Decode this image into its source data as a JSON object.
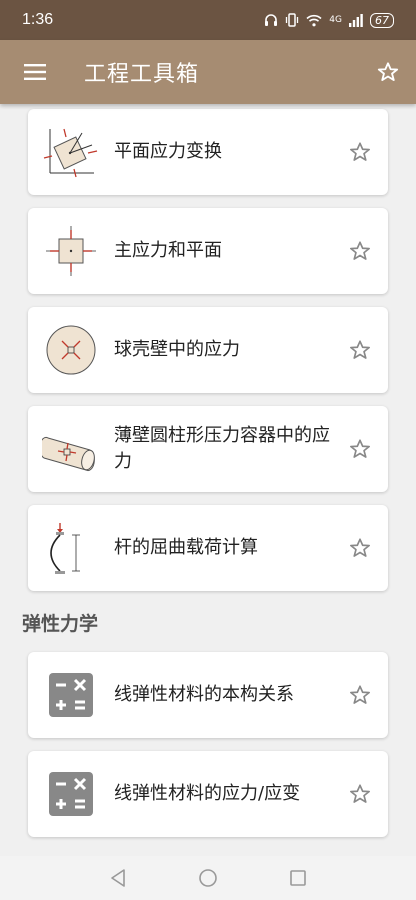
{
  "status": {
    "time": "1:36",
    "battery": "67",
    "network_label": "4G"
  },
  "app_bar": {
    "title": "工程工具箱",
    "menu_icon": "hamburger-menu-icon",
    "favorite_icon": "star-outline-icon"
  },
  "stress_items": [
    {
      "label": "平面应力变换",
      "icon": "plane-stress-transform-diagram"
    },
    {
      "label": "主应力和平面",
      "icon": "principal-stress-diagram"
    },
    {
      "label": "球壳壁中的应力",
      "icon": "spherical-shell-diagram"
    },
    {
      "label": "薄壁圆柱形压力容器中的应力",
      "icon": "thin-walled-cylinder-diagram"
    },
    {
      "label": "杆的屈曲载荷计算",
      "icon": "column-buckling-diagram"
    }
  ],
  "elasticity_section": {
    "title": "弹性力学",
    "items": [
      {
        "label": "线弹性材料的本构关系",
        "icon": "calculator-icon"
      },
      {
        "label": "线弹性材料的应力/应变",
        "icon": "calculator-icon"
      }
    ]
  },
  "colors": {
    "status_bar": "#6b5442",
    "app_bar": "#a68c72",
    "background": "#f0f0f0",
    "star_outline": "#888888"
  }
}
